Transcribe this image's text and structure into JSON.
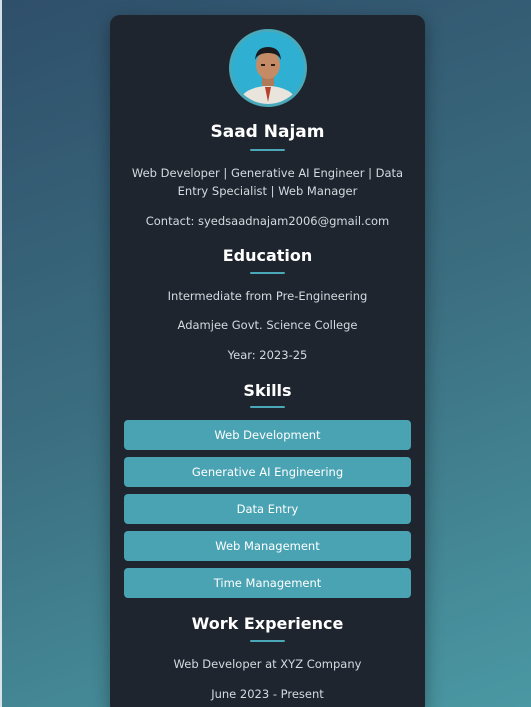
{
  "profile": {
    "name": "Saad Najam",
    "tagline": "Web Developer | Generative AI Engineer | Data Entry Specialist | Web Manager",
    "contact": "Contact: syedsaadnajam2006@gmail.com"
  },
  "education": {
    "heading": "Education",
    "degree": "Intermediate from Pre-Engineering",
    "college": "Adamjee Govt. Science College",
    "year": "Year: 2023-25"
  },
  "skills": {
    "heading": "Skills",
    "items": [
      "Web Development",
      "Generative AI Engineering",
      "Data Entry",
      "Web Management",
      "Time Management"
    ]
  },
  "work": {
    "heading": "Work Experience",
    "role": "Web Developer at XYZ Company",
    "period": "June 2023 - Present"
  },
  "colors": {
    "card_bg": "#1e252e",
    "accent": "#4aa3b3"
  }
}
